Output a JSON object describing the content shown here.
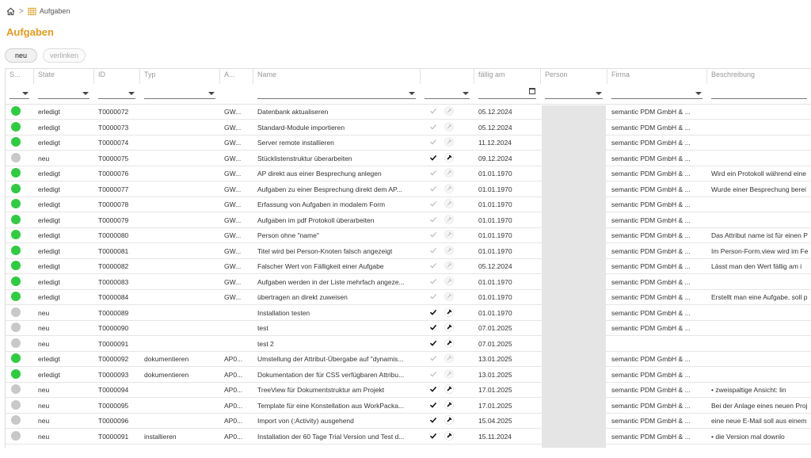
{
  "breadcrumb": {
    "home_icon": "home-icon",
    "table_icon": "table-icon",
    "page": "Aufgaben"
  },
  "title": "Aufgaben",
  "toolbar": {
    "new_label": "neu",
    "link_label": "verlinken"
  },
  "colors": {
    "accent": "#e49a1f",
    "done": "#2ecc40",
    "open": "#c8c8c8"
  },
  "columns": [
    "S...",
    "State",
    "ID",
    "Typ",
    "A...",
    "Name",
    "",
    "fällig am",
    "Person",
    "Firma",
    "Beschreibung"
  ],
  "rows": [
    {
      "status": "done",
      "state": "erledigt",
      "id": "T0000072",
      "typ": "",
      "a": "GW...",
      "name": "Datenbank aktualiseren",
      "checked": false,
      "due": "05.12.2024",
      "firma": "semantic PDM GmbH & ...",
      "desc": ""
    },
    {
      "status": "done",
      "state": "erledigt",
      "id": "T0000073",
      "typ": "",
      "a": "GW...",
      "name": "Standard-Module importieren",
      "checked": false,
      "due": "05.12.2024",
      "firma": "semantic PDM GmbH & ...",
      "desc": ""
    },
    {
      "status": "done",
      "state": "erledigt",
      "id": "T0000074",
      "typ": "",
      "a": "GW...",
      "name": "Server remote installieren",
      "checked": false,
      "due": "11.12.2024",
      "firma": "semantic PDM GmbH & ...",
      "desc": ""
    },
    {
      "status": "open",
      "state": "neu",
      "id": "T0000075",
      "typ": "",
      "a": "GW...",
      "name": "Stücklistenstruktur überarbeiten",
      "checked": true,
      "due": "09.12.2024",
      "firma": "semantic PDM GmbH & ...",
      "desc": ""
    },
    {
      "status": "done",
      "state": "erledigt",
      "id": "T0000076",
      "typ": "",
      "a": "GW...",
      "name": "AP direkt aus einer Besprechung anlegen",
      "checked": false,
      "due": "01.01.1970",
      "firma": "semantic PDM GmbH & ...",
      "desc": "Wird ein Protokoll während eine"
    },
    {
      "status": "done",
      "state": "erledigt",
      "id": "T0000077",
      "typ": "",
      "a": "GW...",
      "name": "Aufgaben zu einer Besprechung direkt dem AP...",
      "checked": false,
      "due": "01.01.1970",
      "firma": "semantic PDM GmbH & ...",
      "desc": "Wurde einer Besprechung berei"
    },
    {
      "status": "done",
      "state": "erledigt",
      "id": "T0000078",
      "typ": "",
      "a": "GW...",
      "name": "Erfassung von Aufgaben in modalem Form",
      "checked": false,
      "due": "01.01.1970",
      "firma": "semantic PDM GmbH & ...",
      "desc": ""
    },
    {
      "status": "done",
      "state": "erledigt",
      "id": "T0000079",
      "typ": "",
      "a": "GW...",
      "name": "Aufgaben im pdf Protokoll überarbeiten",
      "checked": false,
      "due": "01.01.1970",
      "firma": "semantic PDM GmbH & ...",
      "desc": "",
      "descgray": true
    },
    {
      "status": "done",
      "state": "erledigt",
      "id": "T0000080",
      "typ": "",
      "a": "GW...",
      "name": "Person ohne \"name\"",
      "checked": false,
      "due": "01.01.1970",
      "firma": "semantic PDM GmbH & ...",
      "desc": "Das Attribut name ist für einen P"
    },
    {
      "status": "done",
      "state": "erledigt",
      "id": "T0000081",
      "typ": "",
      "a": "GW...",
      "name": "Titel wird bei Person-Knoten falsch angezeigt",
      "checked": false,
      "due": "01.01.1970",
      "firma": "semantic PDM GmbH & ...",
      "desc": "Im Person-Form.view wird im Fe"
    },
    {
      "status": "done",
      "state": "erledigt",
      "id": "T0000082",
      "typ": "",
      "a": "GW...",
      "name": "Falscher Wert von Fälligkeit einer Aufgabe",
      "checked": false,
      "due": "05.12.2024",
      "firma": "semantic PDM GmbH & ...",
      "desc": "Lässt man den Wert fällig am i"
    },
    {
      "status": "done",
      "state": "erledigt",
      "id": "T0000083",
      "typ": "",
      "a": "GW...",
      "name": "Aufgaben werden in der Liste mehrfach angeze...",
      "checked": false,
      "due": "01.01.1970",
      "firma": "semantic PDM GmbH & ...",
      "desc": ""
    },
    {
      "status": "done",
      "state": "erledigt",
      "id": "T0000084",
      "typ": "",
      "a": "GW...",
      "name": "übertragen an direkt zuweisen",
      "checked": false,
      "due": "01.01.1970",
      "firma": "semantic PDM GmbH & ...",
      "desc": "Erstellt man eine Aufgabe, soll p"
    },
    {
      "status": "open",
      "state": "neu",
      "id": "T0000089",
      "typ": "",
      "a": "",
      "name": "Installation testen",
      "checked": true,
      "due": "01.01.1970",
      "firma": "semantic PDM GmbH & ...",
      "desc": ""
    },
    {
      "status": "open",
      "state": "neu",
      "id": "T0000090",
      "typ": "",
      "a": "",
      "name": "test",
      "checked": true,
      "due": "07.01.2025",
      "firma": "semantic PDM GmbH & ...",
      "desc": ""
    },
    {
      "status": "open",
      "state": "neu",
      "id": "T0000091",
      "typ": "",
      "a": "",
      "name": "test 2",
      "checked": true,
      "due": "07.01.2025",
      "firma": "",
      "desc": ""
    },
    {
      "status": "done",
      "state": "erledigt",
      "id": "T0000092",
      "typ": "dokumentieren",
      "a": "AP0...",
      "name": "Umstellung der Attribut-Übergabe auf \"dynamis...",
      "checked": false,
      "due": "13.01.2025",
      "firma": "semantic PDM GmbH & ...",
      "desc": ""
    },
    {
      "status": "done",
      "state": "erledigt",
      "id": "T0000093",
      "typ": "dokumentieren",
      "a": "AP0...",
      "name": "Dokumentation der für CSS verfügbaren Attribu...",
      "checked": false,
      "due": "13.01.2025",
      "firma": "semantic PDM GmbH & ...",
      "desc": ""
    },
    {
      "status": "open",
      "state": "neu",
      "id": "T0000094",
      "typ": "",
      "a": "AP0...",
      "name": "TreeView für Dokumentstruktur am Projekt",
      "checked": true,
      "due": "17.01.2025",
      "firma": "semantic PDM GmbH & ...",
      "desc": "• zweispaltige Ansicht: lin"
    },
    {
      "status": "open",
      "state": "neu",
      "id": "T0000095",
      "typ": "",
      "a": "AP0...",
      "name": "Template für eine Konstellation aus WorkPacka...",
      "checked": true,
      "due": "17.01.2025",
      "firma": "semantic PDM GmbH & ...",
      "desc": "Bei der Anlage eines neuen Proj"
    },
    {
      "status": "open",
      "state": "neu",
      "id": "T0000096",
      "typ": "",
      "a": "AP0...",
      "name": "Import von (:Activity) ausgehend",
      "checked": true,
      "due": "15.04.2025",
      "firma": "semantic PDM GmbH & ...",
      "desc": "eine neue E-Mail soll aus einem"
    },
    {
      "status": "open",
      "state": "neu",
      "id": "T0000091",
      "typ": "installieren",
      "a": "AP0...",
      "name": "Installation der 60 Tage Trial Version und Test d...",
      "checked": true,
      "due": "15.11.2024",
      "firma": "semantic PDM GmbH & ...",
      "desc": "• die Version mal downlo"
    }
  ]
}
